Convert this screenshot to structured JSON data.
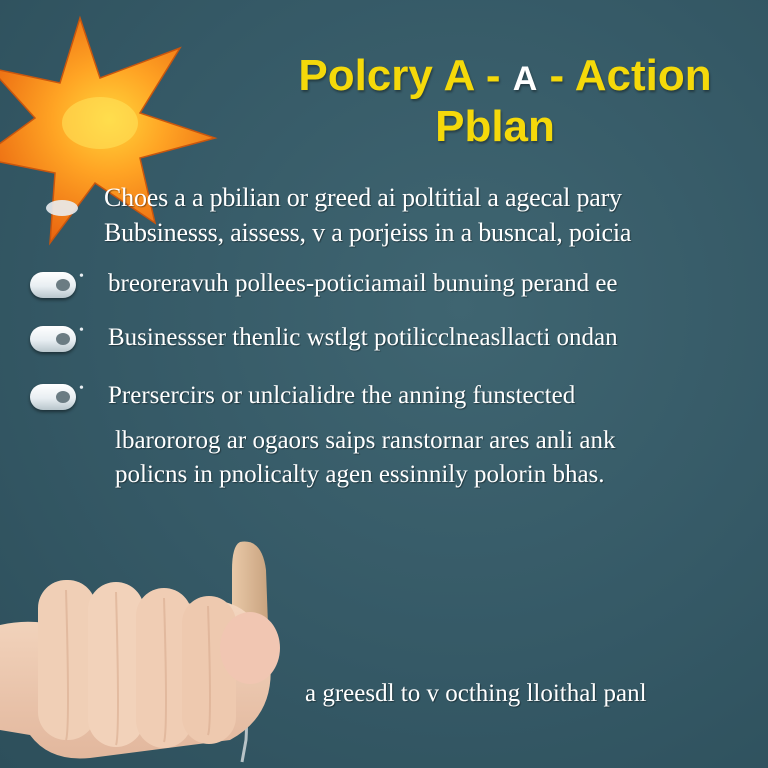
{
  "title": {
    "part1": "Polcry A",
    "sep1": "-",
    "mid": "A",
    "sep2": "-",
    "part2": "Action",
    "line2": "Pblan"
  },
  "intro": [
    "Choes a a pbilian or greed ai poltitial a agecal pary",
    "Bubsinesss, aissess, v a porjeiss in a busncal, poicia"
  ],
  "bullets": [
    "breoreravuh pollees-poticiamail bunuing perand ee",
    "Businessser thenlic wstlgt potilicclneasllacti ondan",
    "Prersercirs or unlcialidre the anning funstected"
  ],
  "paragraph": [
    "lbarororog ar ogaors saips ranstornar ares anli ank",
    "policns in pnolicalty agen essinnily polorin bhas."
  ],
  "footer": "a greesdl to v octhing lloithal panl",
  "icons": {
    "decoration": "star-icon",
    "bullet": "toggle-pill-icon",
    "illustration": "fist-hand-icon"
  },
  "colors": {
    "background": "#355966",
    "title": "#f5d90a",
    "star": "#f7811f",
    "text": "#ffffff"
  }
}
